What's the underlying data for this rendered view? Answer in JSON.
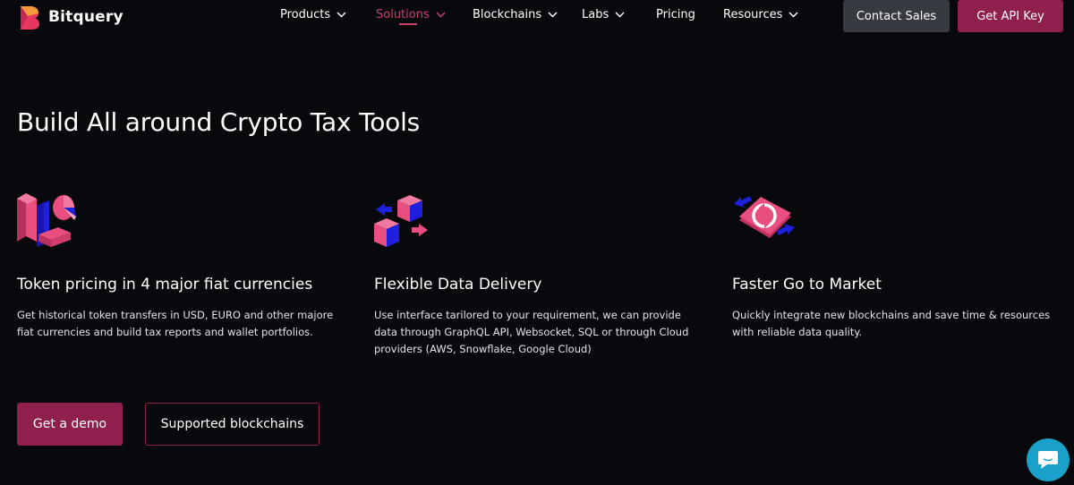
{
  "brand": {
    "name": "Bitquery",
    "logo_icon": "bitquery-logo-icon"
  },
  "nav": [
    {
      "label": "Products",
      "has_dropdown": true,
      "active": false
    },
    {
      "label": "Solutions",
      "has_dropdown": true,
      "active": true
    },
    {
      "label": "Blockchains",
      "has_dropdown": true,
      "active": false
    },
    {
      "label": "Labs",
      "has_dropdown": true,
      "active": false
    },
    {
      "label": "Pricing",
      "has_dropdown": false,
      "active": false
    },
    {
      "label": "Resources",
      "has_dropdown": true,
      "active": false
    }
  ],
  "header_buttons": {
    "contact_sales": "Contact Sales",
    "get_api_key": "Get API Key"
  },
  "hero": {
    "title": "Build All around Crypto Tax Tools"
  },
  "features": [
    {
      "icon": "bar-pie-chart-icon",
      "title": "Token pricing in 4 major fiat currencies",
      "description": "Get historical token transfers in USD, EURO and other majore fiat currencies and build tax reports and wallet portfolios."
    },
    {
      "icon": "data-cubes-exchange-icon",
      "title": "Flexible Data Delivery",
      "description": "Use interface tarilored to your requirement, we can provide data through GraphQL API, Websocket, SQL or through Cloud providers (AWS, Snowflake, Google Cloud)"
    },
    {
      "icon": "sync-arrows-icon",
      "title": "Faster Go to Market",
      "description": "Quickly integrate new blockchains and save time & resources with reliable data quality."
    }
  ],
  "cta": {
    "demo": "Get a demo",
    "supported_blockchains": "Supported blockchains"
  },
  "chat": {
    "icon": "chat-bubble-icon"
  },
  "colors": {
    "background": "#07090c",
    "accent": "#8f1f4c",
    "active_nav": "#c83f6e",
    "pink": "#e84e7e",
    "blue": "#1f1fe0",
    "chat": "#1aa1c9",
    "contact_button": "#373a41"
  }
}
